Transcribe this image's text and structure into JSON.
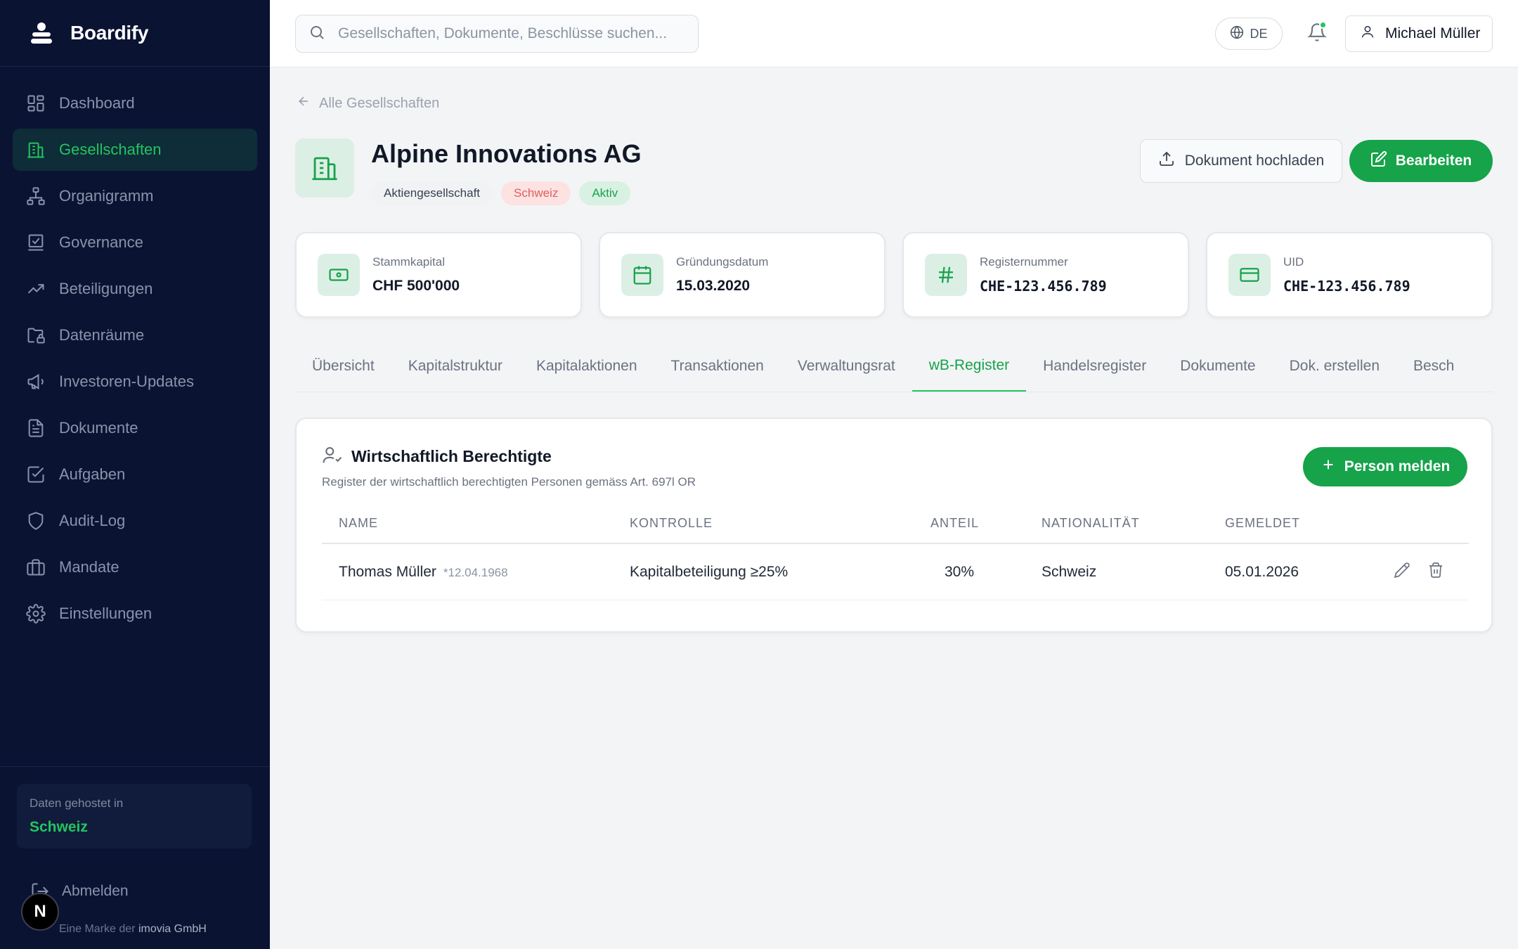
{
  "app": {
    "name": "Boardify"
  },
  "sidebar": {
    "items": [
      {
        "label": "Dashboard",
        "icon": "dashboard-icon",
        "active": false
      },
      {
        "label": "Gesellschaften",
        "icon": "building-icon",
        "active": true
      },
      {
        "label": "Organigramm",
        "icon": "org-chart-icon",
        "active": false
      },
      {
        "label": "Governance",
        "icon": "governance-icon",
        "active": false
      },
      {
        "label": "Beteiligungen",
        "icon": "trending-up-icon",
        "active": false
      },
      {
        "label": "Datenräume",
        "icon": "folder-lock-icon",
        "active": false
      },
      {
        "label": "Investoren-Updates",
        "icon": "megaphone-icon",
        "active": false
      },
      {
        "label": "Dokumente",
        "icon": "document-icon",
        "active": false
      },
      {
        "label": "Aufgaben",
        "icon": "checkbox-icon",
        "active": false
      },
      {
        "label": "Audit-Log",
        "icon": "shield-icon",
        "active": false
      },
      {
        "label": "Mandate",
        "icon": "briefcase-icon",
        "active": false
      },
      {
        "label": "Einstellungen",
        "icon": "gear-icon",
        "active": false
      }
    ],
    "hosting": {
      "label": "Daten gehostet in",
      "value": "Schweiz"
    },
    "logout_label": "Abmelden",
    "brand_note_prefix": "Eine Marke der",
    "brand_note_company": "imovia GmbH",
    "badge_letter": "N"
  },
  "topbar": {
    "search_placeholder": "Gesellschaften, Dokumente, Beschlüsse suchen...",
    "language": "DE",
    "user_name": "Michael Müller"
  },
  "breadcrumb": {
    "back_label": "Alle Gesellschaften"
  },
  "company": {
    "name": "Alpine Innovations AG",
    "tags": {
      "legal_form": "Aktiengesellschaft",
      "country": "Schweiz",
      "status": "Aktiv"
    },
    "upload_label": "Dokument hochladen",
    "edit_label": "Bearbeiten"
  },
  "stats": [
    {
      "label": "Stammkapital",
      "value": "CHF 500'000",
      "icon": "cash-icon"
    },
    {
      "label": "Gründungsdatum",
      "value": "15.03.2020",
      "icon": "calendar-icon"
    },
    {
      "label": "Registernummer",
      "value": "CHE-123.456.789",
      "icon": "hash-icon"
    },
    {
      "label": "UID",
      "value": "CHE-123.456.789",
      "icon": "card-icon"
    }
  ],
  "tabs": [
    {
      "label": "Übersicht",
      "active": false
    },
    {
      "label": "Kapitalstruktur",
      "active": false
    },
    {
      "label": "Kapitalaktionen",
      "active": false
    },
    {
      "label": "Transaktionen",
      "active": false
    },
    {
      "label": "Verwaltungsrat",
      "active": false
    },
    {
      "label": "wB-Register",
      "active": true
    },
    {
      "label": "Handelsregister",
      "active": false
    },
    {
      "label": "Dokumente",
      "active": false
    },
    {
      "label": "Dok. erstellen",
      "active": false
    },
    {
      "label": "Besch",
      "active": false
    }
  ],
  "register": {
    "title": "Wirtschaftlich Berechtigte",
    "subtitle": "Register der wirtschaftlich berechtigten Personen gemäss Art. 697l OR",
    "add_label": "Person melden",
    "columns": {
      "name": "NAME",
      "control": "KONTROLLE",
      "share": "ANTEIL",
      "nationality": "NATIONALITÄT",
      "reported": "GEMELDET"
    },
    "rows": [
      {
        "name": "Thomas Müller",
        "birth": "*12.04.1968",
        "control": "Kapitalbeteiligung ≥25%",
        "share": "30%",
        "nationality": "Schweiz",
        "reported": "05.01.2026"
      }
    ]
  },
  "colors": {
    "accent": "#16a34a",
    "sidebar_bg": "#0b1333",
    "page_bg": "#f3f4f6"
  }
}
